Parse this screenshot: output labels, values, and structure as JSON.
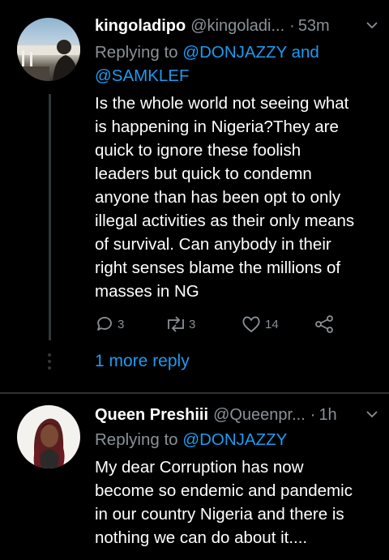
{
  "tweets": [
    {
      "name": "kingoladipo",
      "handle": "@kingoladi...",
      "dot": "·",
      "time": "53m",
      "replying_to": "Replying to",
      "mention1": "@DONJAZZY",
      "and": "and",
      "mention2": "@SAMKLEF",
      "body_lines": [
        "Is the whole world not seeing what",
        "is happening in Nigeria?They are",
        "quick to ignore these foolish",
        "leaders but quick to condemn",
        "anyone than has been opt to only",
        "illegal activities as their only means",
        "of survival. Can anybody in their",
        "right senses blame the millions of",
        "masses in NG"
      ],
      "replies": "3",
      "retweets": "3",
      "likes": "14"
    },
    {
      "name": "Queen Preshiii",
      "handle": "@Queenpr...",
      "dot": "·",
      "time": "1h",
      "replying_to": "Replying to",
      "mention1": "@DONJAZZY",
      "body_lines": [
        "My dear Corruption has now",
        "become so endemic and pandemic",
        "in our country Nigeria and there is",
        "nothing we can do about it...."
      ]
    }
  ],
  "more_reply": "1 more reply",
  "icons": {
    "reply": "reply-icon",
    "retweet": "retweet-icon",
    "like": "heart-icon",
    "share": "share-icon",
    "more": "chevron-down-icon"
  },
  "colors": {
    "background": "#000000",
    "accent": "#1d9bf0",
    "secondary": "#8a9197",
    "divider": "#2f3336"
  }
}
